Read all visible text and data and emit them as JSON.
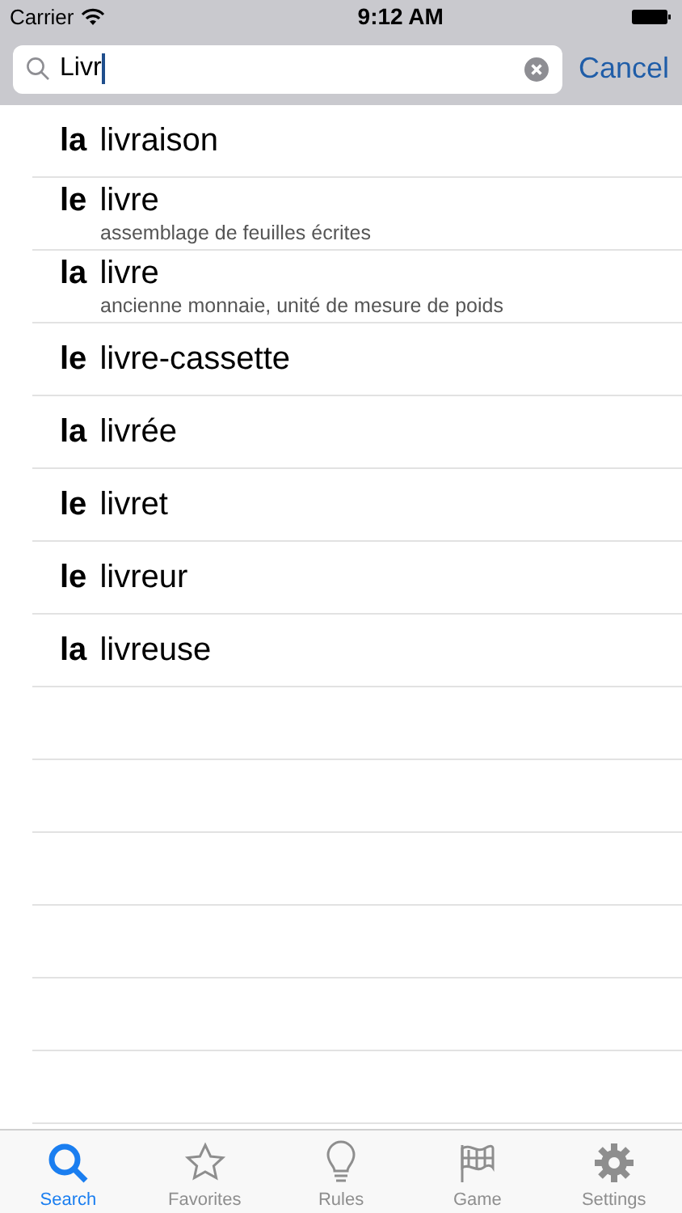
{
  "status_bar": {
    "carrier": "Carrier",
    "time": "9:12 AM"
  },
  "search": {
    "value": "Livr",
    "cancel": "Cancel"
  },
  "results": [
    {
      "article": "la",
      "word": "livraison"
    },
    {
      "article": "le",
      "word": "livre",
      "gloss": "assemblage de feuilles écrites"
    },
    {
      "article": "la",
      "word": "livre",
      "gloss": "ancienne monnaie, unité de mesure de poids"
    },
    {
      "article": "le",
      "word": "livre-cassette"
    },
    {
      "article": "la",
      "word": "livrée"
    },
    {
      "article": "le",
      "word": "livret"
    },
    {
      "article": "le",
      "word": "livreur"
    },
    {
      "article": "la",
      "word": "livreuse"
    }
  ],
  "tabs": [
    {
      "kind": "search",
      "label": "Search",
      "selected": true
    },
    {
      "kind": "star",
      "label": "Favorites",
      "selected": false
    },
    {
      "kind": "bulb",
      "label": "Rules",
      "selected": false
    },
    {
      "kind": "flag",
      "label": "Game",
      "selected": false
    },
    {
      "kind": "gear",
      "label": "Settings",
      "selected": false
    }
  ]
}
